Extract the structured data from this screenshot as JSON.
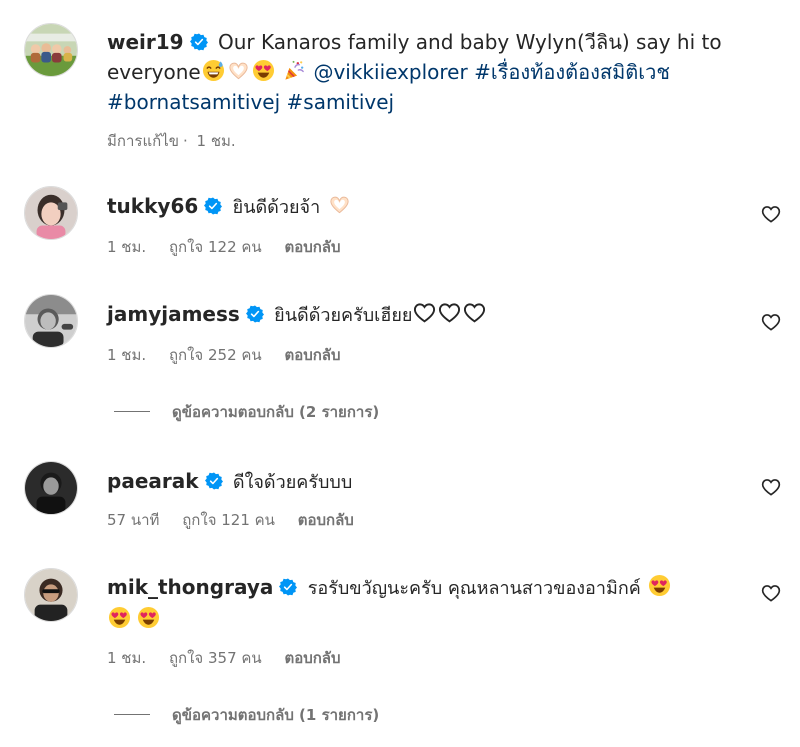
{
  "post": {
    "username": "weir19",
    "caption_text": "Our Kanaros family and baby Wylyn(วีลิน) say hi to",
    "caption_line2": "everyone",
    "mention": "@vikkiiexplorer",
    "hashtag1": "#เรื่องท้องต้องสมิติเวช",
    "hashtag2": "#bornatsamitivej",
    "hashtag3": "#samitivej",
    "edited": "มีการแก้ไข",
    "time": "1 ชม."
  },
  "comments": [
    {
      "username": "tukky66",
      "text": "ยินดีด้วยจ้า",
      "time": "1 ชม.",
      "likes": "ถูกใจ 122 คน",
      "reply": "ตอบกลับ"
    },
    {
      "username": "jamyjamess",
      "text": "ยินดีด้วยครับเฮียย",
      "time": "1 ชม.",
      "likes": "ถูกใจ 252 คน",
      "reply": "ตอบกลับ",
      "view_replies": "ดูข้อความตอบกลับ (2 รายการ)"
    },
    {
      "username": "paearak",
      "text": "ดีใจด้วยครับบบ",
      "time": "57 นาที",
      "likes": "ถูกใจ 121 คน",
      "reply": "ตอบกลับ"
    },
    {
      "username": "mik_thongraya",
      "text": "รอรับขวัญนะครับ คุณหลานสาวของอามิกค์",
      "time": "1 ชม.",
      "likes": "ถูกใจ 357 คน",
      "reply": "ตอบกลับ",
      "view_replies": "ดูข้อความตอบกลับ (1 รายการ)"
    }
  ],
  "colors": {
    "link": "#00376b",
    "verified": "#0095f6",
    "muted": "#737373",
    "text": "#262626"
  },
  "icons": [
    "verified-badge-icon",
    "heart-outline-icon",
    "grinning-sweat-emoji",
    "heart-eyes-emoji",
    "party-popper-emoji",
    "heart-hands-emoji"
  ]
}
